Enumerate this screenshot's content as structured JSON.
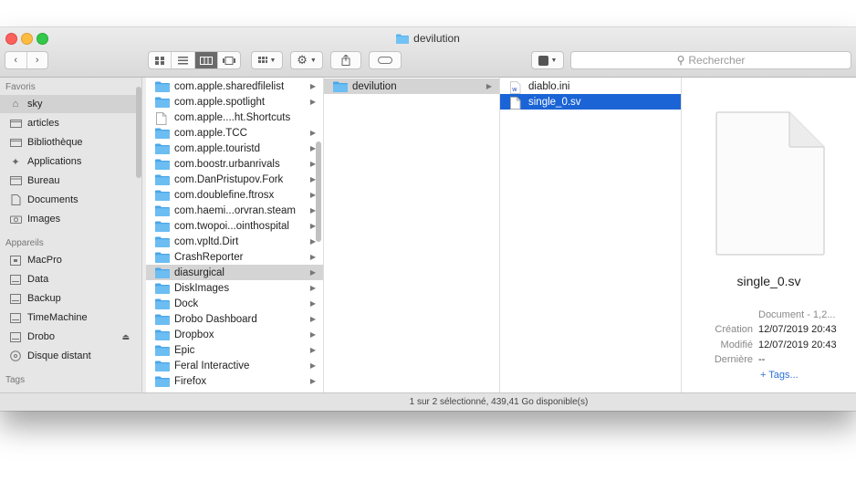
{
  "window": {
    "title": "devilution"
  },
  "toolbar": {
    "back_icon": "chevron-left-icon",
    "forward_icon": "chevron-right-icon",
    "view_modes": [
      "icon-view-icon",
      "list-view-icon",
      "column-view-icon",
      "gallery-view-icon"
    ],
    "group_icon": "grid-icon",
    "action_icon": "gear-icon",
    "share_icon": "share-icon",
    "tag_icon": "tag-icon",
    "app_icon": "app-icon",
    "search_placeholder": "Rechercher"
  },
  "sidebar": {
    "favorites_header": "Favoris",
    "favorites": [
      {
        "label": "sky",
        "icon": "home-icon",
        "selected": true
      },
      {
        "label": "articles",
        "icon": "folder-icon"
      },
      {
        "label": "Bibliothèque",
        "icon": "folder-icon"
      },
      {
        "label": "Applications",
        "icon": "applications-icon"
      },
      {
        "label": "Bureau",
        "icon": "desktop-icon"
      },
      {
        "label": "Documents",
        "icon": "document-icon"
      },
      {
        "label": "Images",
        "icon": "camera-icon"
      }
    ],
    "devices_header": "Appareils",
    "devices": [
      {
        "label": "MacPro",
        "icon": "computer-icon"
      },
      {
        "label": "Data",
        "icon": "disk-icon"
      },
      {
        "label": "Backup",
        "icon": "disk-icon"
      },
      {
        "label": "TimeMachine",
        "icon": "disk-icon"
      },
      {
        "label": "Drobo",
        "icon": "disk-icon",
        "eject": "⏏"
      },
      {
        "label": "Disque distant",
        "icon": "optical-disc-icon"
      }
    ],
    "tags_header": "Tags"
  },
  "column1": {
    "items": [
      {
        "label": "com.apple.sharedfilelist",
        "folder": true
      },
      {
        "label": "com.apple.spotlight",
        "folder": true
      },
      {
        "label": "com.apple....ht.Shortcuts",
        "folder": false
      },
      {
        "label": "com.apple.TCC",
        "folder": true
      },
      {
        "label": "com.apple.touristd",
        "folder": true
      },
      {
        "label": "com.boostr.urbanrivals",
        "folder": true
      },
      {
        "label": "com.DanPristupov.Fork",
        "folder": true
      },
      {
        "label": "com.doublefine.ftrosx",
        "folder": true
      },
      {
        "label": "com.haemi...orvran.steam",
        "folder": true
      },
      {
        "label": "com.twopoi...ointhospital",
        "folder": true
      },
      {
        "label": "com.vpltd.Dirt",
        "folder": true
      },
      {
        "label": "CrashReporter",
        "folder": true
      },
      {
        "label": "diasurgical",
        "folder": true,
        "selected": true
      },
      {
        "label": "DiskImages",
        "folder": true
      },
      {
        "label": "Dock",
        "folder": true
      },
      {
        "label": "Drobo Dashboard",
        "folder": true
      },
      {
        "label": "Dropbox",
        "folder": true
      },
      {
        "label": "Epic",
        "folder": true
      },
      {
        "label": "Feral Interactive",
        "folder": true
      },
      {
        "label": "Firefox",
        "folder": true
      }
    ]
  },
  "column2": {
    "items": [
      {
        "label": "devilution",
        "folder": true,
        "selected": true
      }
    ]
  },
  "column3": {
    "items": [
      {
        "label": "diablo.ini",
        "icon": "ini-file-icon"
      },
      {
        "label": "single_0.sv",
        "icon": "document-icon",
        "selected": true
      }
    ]
  },
  "preview": {
    "name": "single_0.sv",
    "kind_value": "Document - 1,2...",
    "created_label": "Création",
    "created_value": "12/07/2019 20:43",
    "modified_label": "Modifié",
    "modified_value": "12/07/2019 20:43",
    "last_label": "Dernière",
    "last_value": "--",
    "tags_link": "+ Tags..."
  },
  "status": {
    "text": "1 sur 2 sélectionné, 439,41 Go disponible(s)"
  },
  "colors": {
    "selection_blue": "#1b64d6",
    "folder_blue": "#5ab2ef"
  }
}
